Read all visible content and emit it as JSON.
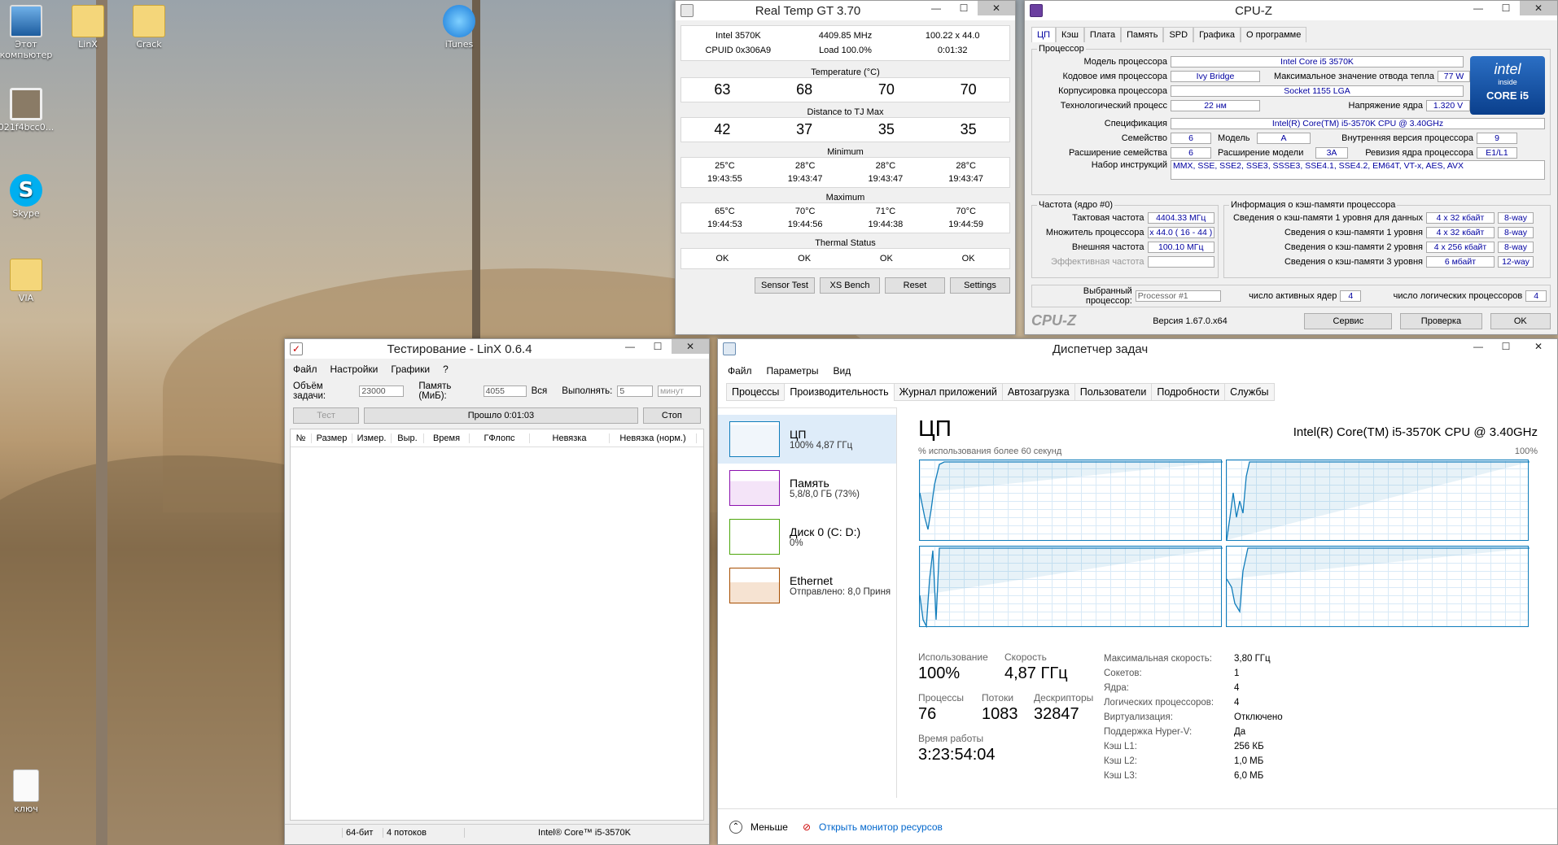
{
  "desktop": {
    "icons": [
      {
        "label": "Этот компьютер",
        "icon": "computer-icon"
      },
      {
        "label": "LinX",
        "icon": "folder-icon"
      },
      {
        "label": "Crack",
        "icon": "folder-icon"
      },
      {
        "label": "iTunes",
        "icon": "itunes-icon"
      },
      {
        "label": "021f4bcc0...",
        "icon": "image-file-icon"
      },
      {
        "label": "Skype",
        "icon": "skype-icon"
      },
      {
        "label": "VIA",
        "icon": "folder-icon"
      },
      {
        "label": "ключ",
        "icon": "text-file-icon"
      }
    ]
  },
  "realtemp": {
    "title": "Real Temp GT 3.70",
    "cpu": "Intel 3570K",
    "mhz": "4409.85 MHz",
    "mult": "100.22 x 44.0",
    "cpuid": "CPUID  0x306A9",
    "load": "Load 100.0%",
    "time": "0:01:32",
    "temp_label": "Temperature (°C)",
    "temps": [
      "63",
      "68",
      "70",
      "70"
    ],
    "dist_label": "Distance to TJ Max",
    "dists": [
      "42",
      "37",
      "35",
      "35"
    ],
    "min_label": "Minimum",
    "min_t": [
      "25°C",
      "28°C",
      "28°C",
      "28°C"
    ],
    "min_time": [
      "19:43:55",
      "19:43:47",
      "19:43:47",
      "19:43:47"
    ],
    "max_label": "Maximum",
    "max_t": [
      "65°C",
      "70°C",
      "71°C",
      "70°C"
    ],
    "max_time": [
      "19:44:53",
      "19:44:56",
      "19:44:38",
      "19:44:59"
    ],
    "status_label": "Thermal Status",
    "status": [
      "OK",
      "OK",
      "OK",
      "OK"
    ],
    "buttons": {
      "sensor": "Sensor Test",
      "xs": "XS Bench",
      "reset": "Reset",
      "settings": "Settings"
    }
  },
  "cpuz": {
    "title": "CPU-Z",
    "tabs": [
      "ЦП",
      "Кэш",
      "Плата",
      "Память",
      "SPD",
      "Графика",
      "О программе"
    ],
    "group_cpu": "Процессор",
    "model_l": "Модель процессора",
    "model": "Intel Core i5 3570K",
    "code_l": "Кодовое имя процессора",
    "code": "Ivy Bridge",
    "tdp_l": "Максимальное значение отвода тепла",
    "tdp": "77 W",
    "pkg_l": "Корпусировка процессора",
    "pkg": "Socket 1155 LGA",
    "tech_l": "Технологический процесс",
    "tech": "22 нм",
    "volt_l": "Напряжение ядра",
    "volt": "1.320 V",
    "spec_l": "Спецификация",
    "spec": "Intel(R) Core(TM) i5-3570K CPU @ 3.40GHz",
    "fam_l": "Семейство",
    "fam": "6",
    "mod_l": "Модель",
    "mod": "A",
    "step_l": "Внутренняя версия процессора",
    "step": "9",
    "extfam_l": "Расширение семейства",
    "extfam": "6",
    "extmod_l": "Расширение модели",
    "extmod": "3A",
    "rev_l": "Ревизия ядра процессора",
    "rev": "E1/L1",
    "inst_l": "Набор инструкций",
    "inst": "MMX, SSE, SSE2, SSE3, SSSE3, SSE4.1, SSE4.2, EM64T, VT-x, AES, AVX",
    "clk_group": "Частота (ядро #0)",
    "core_l": "Тактовая частота",
    "core": "4404.33 МГц",
    "multi_l": "Множитель процессора",
    "multi": "x 44.0  ( 16 - 44 )",
    "bus_l": "Внешняя частота",
    "bus": "100.10 МГц",
    "eff_l": "Эффективная частота",
    "eff": "",
    "cache_group": "Информация о кэш-памяти процессора",
    "cache": [
      {
        "l": "Сведения о кэш-памяти 1 уровня для данных",
        "v": "4 x 32 кбайт",
        "w": "8-way"
      },
      {
        "l": "Сведения о кэш-памяти 1 уровня",
        "v": "4 x 32 кбайт",
        "w": "8-way"
      },
      {
        "l": "Сведения о кэш-памяти 2 уровня",
        "v": "4 x 256 кбайт",
        "w": "8-way"
      },
      {
        "l": "Сведения о кэш-памяти 3 уровня",
        "v": "6 мбайт",
        "w": "12-way"
      }
    ],
    "sel_l": "Выбранный процессор:",
    "sel": "Processor #1",
    "cores_l": "число активных ядер",
    "cores": "4",
    "threads_l": "число логических процессоров",
    "threads": "4",
    "brand": "CPU-Z",
    "version": "Версия 1.67.0.x64",
    "btn_service": "Сервис",
    "btn_check": "Проверка",
    "btn_ok": "OK",
    "logo_top": "intel",
    "logo_inside": "inside",
    "logo_bottom": "CORE i5"
  },
  "linx": {
    "title": "Тестирование - LinX 0.6.4",
    "menu": [
      "Файл",
      "Настройки",
      "Графики",
      "?"
    ],
    "size_l": "Объём задачи:",
    "size": "23000",
    "mem_l": "Память (МиБ):",
    "mem": "4055",
    "all": "Вся",
    "run_l": "Выполнять:",
    "run": "5",
    "unit": "минут",
    "btn_test": "Тест",
    "elapsed": "Прошло 0:01:03",
    "btn_stop": "Стоп",
    "cols": [
      "№",
      "Размер",
      "Измер.",
      "Выр.",
      "Время",
      "ГФлопс",
      "Невязка",
      "Невязка (норм.)"
    ],
    "status": {
      "bits": "64-бит",
      "threads": "4 потоков",
      "cpu": "Intel® Core™ i5-3570K"
    }
  },
  "taskmgr": {
    "title": "Диспетчер задач",
    "menu": [
      "Файл",
      "Параметры",
      "Вид"
    ],
    "tabs": [
      "Процессы",
      "Производительность",
      "Журнал приложений",
      "Автозагрузка",
      "Пользователи",
      "Подробности",
      "Службы"
    ],
    "side": [
      {
        "name": "ЦП",
        "sub": "100% 4,87 ГГц",
        "color": "#117dbb"
      },
      {
        "name": "Память",
        "sub": "5,8/8,0 ГБ (73%)",
        "color": "#8b12ae"
      },
      {
        "name": "Диск 0 (C: D:)",
        "sub": "0%",
        "color": "#4da60c"
      },
      {
        "name": "Ethernet",
        "sub": "Отправлено: 8,0  Приня",
        "color": "#a74f01"
      }
    ],
    "heading": "ЦП",
    "cpu_name": "Intel(R) Core(TM) i5-3570K CPU @ 3.40GHz",
    "graph_caption": "% использования более 60 секунд",
    "graph_max": "100%",
    "usage_l": "Использование",
    "usage": "100%",
    "speed_l": "Скорость",
    "speed": "4,87 ГГц",
    "proc_l": "Процессы",
    "proc": "76",
    "thr_l": "Потоки",
    "thr": "1083",
    "desc_l": "Дескрипторы",
    "desc": "32847",
    "uptime_l": "Время работы",
    "uptime": "3:23:54:04",
    "info": [
      {
        "k": "Максимальная скорость:",
        "v": "3,80 ГГц"
      },
      {
        "k": "Сокетов:",
        "v": "1"
      },
      {
        "k": "Ядра:",
        "v": "4"
      },
      {
        "k": "Логических процессоров:",
        "v": "4"
      },
      {
        "k": "Виртуализация:",
        "v": "Отключено"
      },
      {
        "k": "Поддержка Hyper-V:",
        "v": "Да"
      },
      {
        "k": "Кэш L1:",
        "v": "256 КБ"
      },
      {
        "k": "Кэш L2:",
        "v": "1,0 МБ"
      },
      {
        "k": "Кэш L3:",
        "v": "6,0 МБ"
      }
    ],
    "less": "Меньше",
    "monitor": "Открыть монитор ресурсов"
  }
}
